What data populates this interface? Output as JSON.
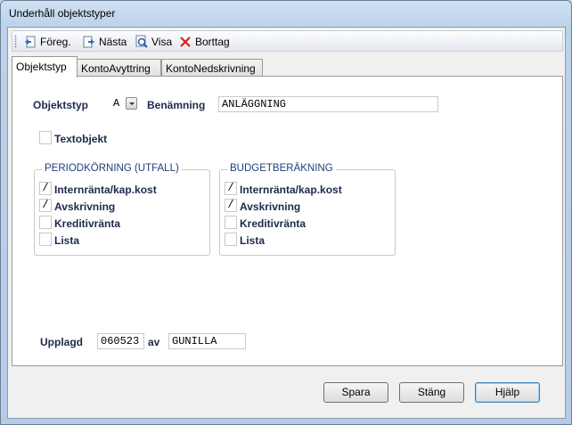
{
  "window": {
    "title": "Underhåll objektstyper"
  },
  "toolbar": {
    "prev_label": "Föreg.",
    "next_label": "Nästa",
    "view_label": "Visa",
    "delete_label": "Borttag",
    "icons": [
      "previous-icon",
      "next-icon",
      "view-icon",
      "delete-icon"
    ]
  },
  "tabs": [
    "Objektstyp",
    "KontoAvyttring",
    "KontoNedskrivning"
  ],
  "form": {
    "objektstyp_label": "Objektstyp",
    "objektstyp_value": "A",
    "benamning_label": "Benämning",
    "benamning_value": "ANLÄGGNING",
    "textobjekt_label": "Textobjekt",
    "textobjekt_value": ""
  },
  "periodkorning": {
    "title": "PERIODKÖRNING (UTFALL)",
    "items": [
      {
        "label": "Internränta/kap.kost",
        "value": "/"
      },
      {
        "label": "Avskrivning",
        "value": "/"
      },
      {
        "label": "Kreditivränta",
        "value": ""
      },
      {
        "label": "Lista",
        "value": ""
      }
    ]
  },
  "budget": {
    "title": "BUDGETBERÄKNING",
    "items": [
      {
        "label": "Internränta/kap.kost",
        "value": "/"
      },
      {
        "label": "Avskrivning",
        "value": "/"
      },
      {
        "label": "Kreditivränta",
        "value": ""
      },
      {
        "label": "Lista",
        "value": ""
      }
    ]
  },
  "upplagd": {
    "label": "Upplagd",
    "date": "060523",
    "av_label": "av",
    "user": "GUNILLA"
  },
  "buttons": {
    "save": "Spara",
    "close": "Stäng",
    "help": "Hjälp"
  }
}
